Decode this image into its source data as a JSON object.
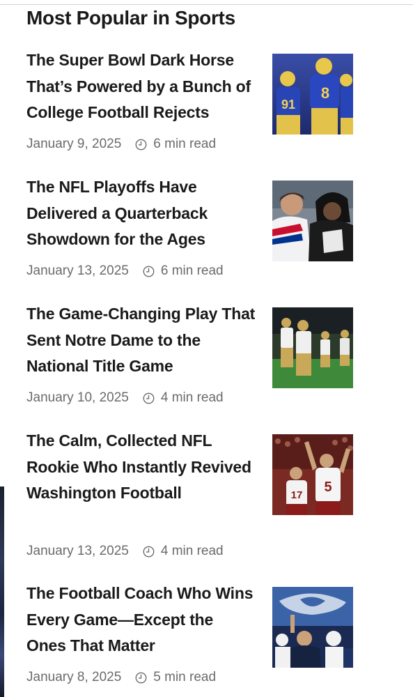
{
  "section": {
    "title": "Most Popular in Sports"
  },
  "articles": [
    {
      "headline": "The Super Bowl Dark Horse That’s Powered by a Bunch of College Football Rejects",
      "date": "January 9, 2025",
      "read_time": "6 min read",
      "thumb_icon": "rams-players-photo"
    },
    {
      "headline": "The NFL Playoffs Have Delivered a Quarterback Showdown for the Ages",
      "date": "January 13, 2025",
      "read_time": "6 min read",
      "thumb_icon": "quarterbacks-embrace-photo"
    },
    {
      "headline": "The Game-Changing Play That Sent Notre Dame to the National Title Game",
      "date": "January 10, 2025",
      "read_time": "4 min read",
      "thumb_icon": "notre-dame-players-photo"
    },
    {
      "headline": "The Calm, Collected NFL Rookie Who Instantly Revived Washington Football",
      "date": "January 13, 2025",
      "read_time": "4 min read",
      "thumb_icon": "washington-rookie-photo"
    },
    {
      "headline": "The Football Coach Who Wins Every Game—Except the Ones That Matter",
      "date": "January 8, 2025",
      "read_time": "5 min read",
      "thumb_icon": "penn-state-coach-photo"
    }
  ],
  "thumb_numbers": [
    "91",
    "8",
    "5",
    "17"
  ],
  "colors": {
    "headline": "#1a1a1a",
    "meta": "#6b6b6b",
    "rule": "#d3d3d3"
  }
}
